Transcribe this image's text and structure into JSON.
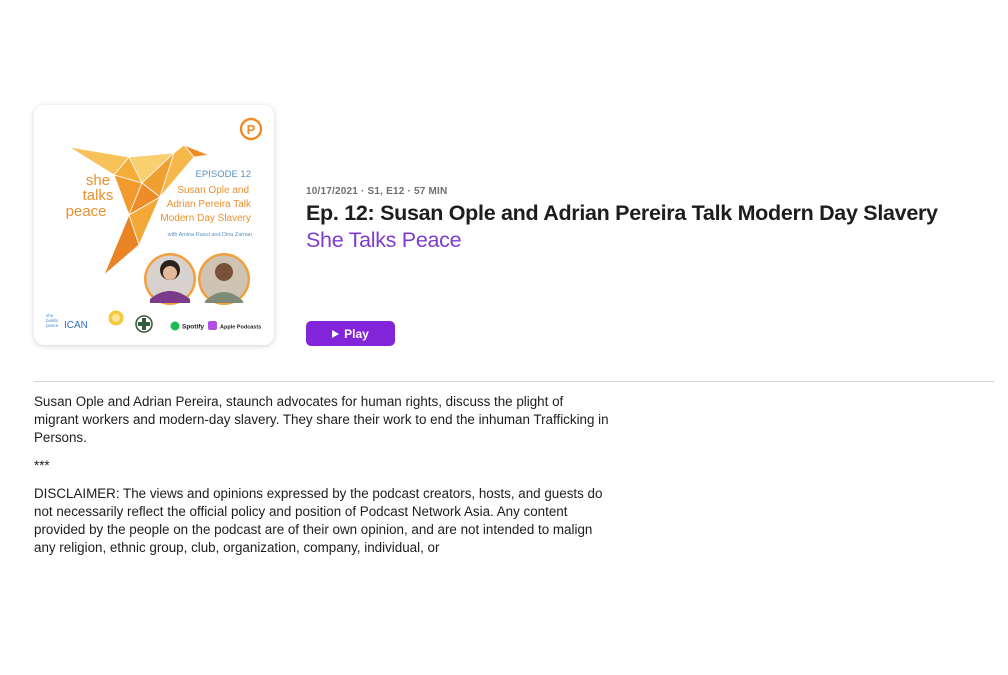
{
  "artwork": {
    "brand_badge_icon": "podcast-network-p-logo-icon",
    "episode_label": "EPISODE 12",
    "title_lines": [
      "Susan Ople and",
      "Adrian Pereira Talk",
      "Modern Day Slavery"
    ],
    "hosts_line": "with Amina Rasul and Dina Zaman",
    "show_wordmark": [
      "she",
      "talks",
      "peace"
    ],
    "partner_logos": {
      "she_builds_peace": [
        "she",
        "builds",
        "peace"
      ],
      "ican": "ICAN",
      "spotify": "Spotify",
      "apple_podcasts": "Apple Podcasts"
    },
    "accent_color": "#f2a03d",
    "text_color": "#e8912f"
  },
  "episode": {
    "meta": "10/17/2021 · S1, E12 · 57 MIN",
    "title": "Ep. 12: Susan Ople and Adrian Pereira Talk Modern Day Slavery",
    "show_name": "She Talks Peace",
    "show_color": "#7d3ccf"
  },
  "play_button": {
    "label": "Play",
    "icon": "play-triangle-icon",
    "color": "#8124da"
  },
  "description": {
    "paragraphs": [
      "Susan Ople and Adrian Pereira, staunch advocates for human rights, discuss the plight of migrant workers and modern-day slavery. They share their work to end the inhuman Trafficking in Persons.",
      "***",
      "DISCLAIMER: The views and opinions expressed by the podcast creators, hosts, and guests do not necessarily reflect the official policy and position of Podcast Network Asia. Any content provided by the people on the podcast are of their own opinion, and are not intended to malign any religion, ethnic group, club, organization, company, individual, or"
    ]
  }
}
